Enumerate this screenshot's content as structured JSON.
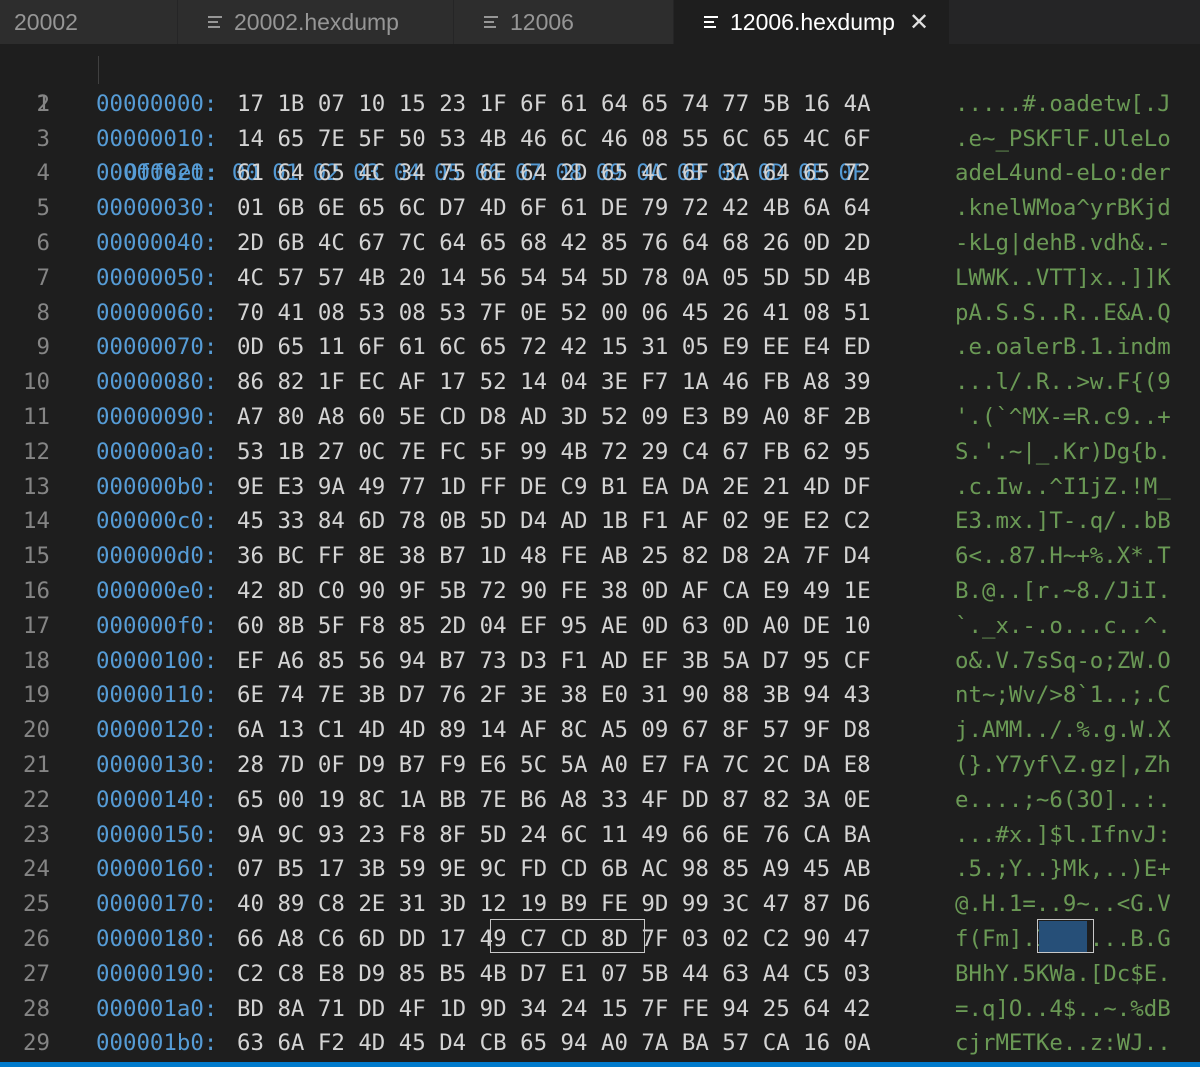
{
  "tabs": [
    {
      "label": "20002",
      "icon": "none",
      "active": false
    },
    {
      "label": "20002.hexdump",
      "icon": "text-file-icon",
      "active": false
    },
    {
      "label": "12006",
      "icon": "text-file-icon",
      "active": false
    },
    {
      "label": "12006.hexdump",
      "icon": "text-file-icon",
      "active": true,
      "close": "✕"
    }
  ],
  "editor": {
    "header": {
      "line": "1",
      "text": "Offset: 00 01 02 03 04 05 06 07 08 09 0A 0B 0C 0D 0E 0F"
    },
    "rows": [
      {
        "line": "2",
        "offset": "00000000:",
        "hex": "17 1B 07 10 15 23 1F 6F 61 64 65 74 77 5B 16 4A",
        "ascii": ".....#.oadetw[.J"
      },
      {
        "line": "3",
        "offset": "00000010:",
        "hex": "14 65 7E 5F 50 53 4B 46 6C 46 08 55 6C 65 4C 6F",
        "ascii": ".e~_PSKFlF.UleLo"
      },
      {
        "line": "4",
        "offset": "00000020:",
        "hex": "61 64 65 4C 34 75 6E 64 2D 65 4C 6F 3A 64 65 72",
        "ascii": "adeL4und-eLo:der"
      },
      {
        "line": "5",
        "offset": "00000030:",
        "hex": "01 6B 6E 65 6C D7 4D 6F 61 DE 79 72 42 4B 6A 64",
        "ascii": ".knelWMoa^yrBKjd"
      },
      {
        "line": "6",
        "offset": "00000040:",
        "hex": "2D 6B 4C 67 7C 64 65 68 42 85 76 64 68 26 0D 2D",
        "ascii": "-kLg|dehB.vdh&.-"
      },
      {
        "line": "7",
        "offset": "00000050:",
        "hex": "4C 57 57 4B 20 14 56 54 54 5D 78 0A 05 5D 5D 4B",
        "ascii": "LWWK..VTT]x..]]K"
      },
      {
        "line": "8",
        "offset": "00000060:",
        "hex": "70 41 08 53 08 53 7F 0E 52 00 06 45 26 41 08 51",
        "ascii": "pA.S.S..R..E&A.Q"
      },
      {
        "line": "9",
        "offset": "00000070:",
        "hex": "0D 65 11 6F 61 6C 65 72 42 15 31 05 E9 EE E4 ED",
        "ascii": ".e.oalerB.1.indm"
      },
      {
        "line": "10",
        "offset": "00000080:",
        "hex": "86 82 1F EC AF 17 52 14 04 3E F7 1A 46 FB A8 39",
        "ascii": "...l/.R..>w.F{(9"
      },
      {
        "line": "11",
        "offset": "00000090:",
        "hex": "A7 80 A8 60 5E CD D8 AD 3D 52 09 E3 B9 A0 8F 2B",
        "ascii": "'.(`^MX-=R.c9..+"
      },
      {
        "line": "12",
        "offset": "000000a0:",
        "hex": "53 1B 27 0C 7E FC 5F 99 4B 72 29 C4 67 FB 62 95",
        "ascii": "S.'.~|_.Kr)Dg{b."
      },
      {
        "line": "13",
        "offset": "000000b0:",
        "hex": "9E E3 9A 49 77 1D FF DE C9 B1 EA DA 2E 21 4D DF",
        "ascii": ".c.Iw..^I1jZ.!M_"
      },
      {
        "line": "14",
        "offset": "000000c0:",
        "hex": "45 33 84 6D 78 0B 5D D4 AD 1B F1 AF 02 9E E2 C2",
        "ascii": "E3.mx.]T-.q/..bB"
      },
      {
        "line": "15",
        "offset": "000000d0:",
        "hex": "36 BC FF 8E 38 B7 1D 48 FE AB 25 82 D8 2A 7F D4",
        "ascii": "6<..87.H~+%.X*.T"
      },
      {
        "line": "16",
        "offset": "000000e0:",
        "hex": "42 8D C0 90 9F 5B 72 90 FE 38 0D AF CA E9 49 1E",
        "ascii": "B.@..[r.~8./JiI."
      },
      {
        "line": "17",
        "offset": "000000f0:",
        "hex": "60 8B 5F F8 85 2D 04 EF 95 AE 0D 63 0D A0 DE 10",
        "ascii": "`._x.-.o...c..^."
      },
      {
        "line": "18",
        "offset": "00000100:",
        "hex": "EF A6 85 56 94 B7 73 D3 F1 AD EF 3B 5A D7 95 CF",
        "ascii": "o&.V.7sSq-o;ZW.O"
      },
      {
        "line": "19",
        "offset": "00000110:",
        "hex": "6E 74 7E 3B D7 76 2F 3E 38 E0 31 90 88 3B 94 43",
        "ascii": "nt~;Wv/>8`1..;.C"
      },
      {
        "line": "20",
        "offset": "00000120:",
        "hex": "6A 13 C1 4D 4D 89 14 AF 8C A5 09 67 8F 57 9F D8",
        "ascii": "j.AMM../.%.g.W.X"
      },
      {
        "line": "21",
        "offset": "00000130:",
        "hex": "28 7D 0F D9 B7 F9 E6 5C 5A A0 E7 FA 7C 2C DA E8",
        "ascii": "(}.Y7yf\\Z.gz|,Zh"
      },
      {
        "line": "22",
        "offset": "00000140:",
        "hex": "65 00 19 8C 1A BB 7E B6 A8 33 4F DD 87 82 3A 0E",
        "ascii": "e....;~6(3O]..:."
      },
      {
        "line": "23",
        "offset": "00000150:",
        "hex": "9A 9C 93 23 F8 8F 5D 24 6C 11 49 66 6E 76 CA BA",
        "ascii": "...#x.]$l.IfnvJ:"
      },
      {
        "line": "24",
        "offset": "00000160:",
        "hex": "07 B5 17 3B 59 9E 9C FD CD 6B AC 98 85 A9 45 AB",
        "ascii": ".5.;Y..}Mk,..)E+"
      },
      {
        "line": "25",
        "offset": "00000170:",
        "hex": "40 89 C8 2E 31 3D 12 19 B9 FE 9D 99 3C 47 87 D6",
        "ascii": "@.H.1=..9~..<G.V"
      },
      {
        "line": "26",
        "offset": "00000180:",
        "hex": "66 A8 C6 6D DD 17 49 C7 CD 8D 7F 03 02 C2 90 47",
        "ascii": "f(Fm].IGM....B.G"
      },
      {
        "line": "27",
        "offset": "00000190:",
        "hex": "C2 C8 E8 D9 85 B5 4B D7 E1 07 5B 44 63 A4 C5 03",
        "ascii": "BHhY.5KWa.[Dc$E."
      },
      {
        "line": "28",
        "offset": "000001a0:",
        "hex": "BD 8A 71 DD 4F 1D 9D 34 24 15 7F FE 94 25 64 42",
        "ascii": "=.q]O..4$..~.%dB"
      },
      {
        "line": "29",
        "offset": "000001b0:",
        "hex": "63 6A F2 4D 45 D4 CB 65 94 A0 7A BA 57 CA 16 0A",
        "ascii": "cjrMETKe..z:WJ.."
      }
    ]
  },
  "colors": {
    "offset": "#569cd6",
    "hex": "#d4d4d4",
    "ascii": "#6a9955",
    "line_number": "#858585",
    "accent": "#007acc"
  }
}
